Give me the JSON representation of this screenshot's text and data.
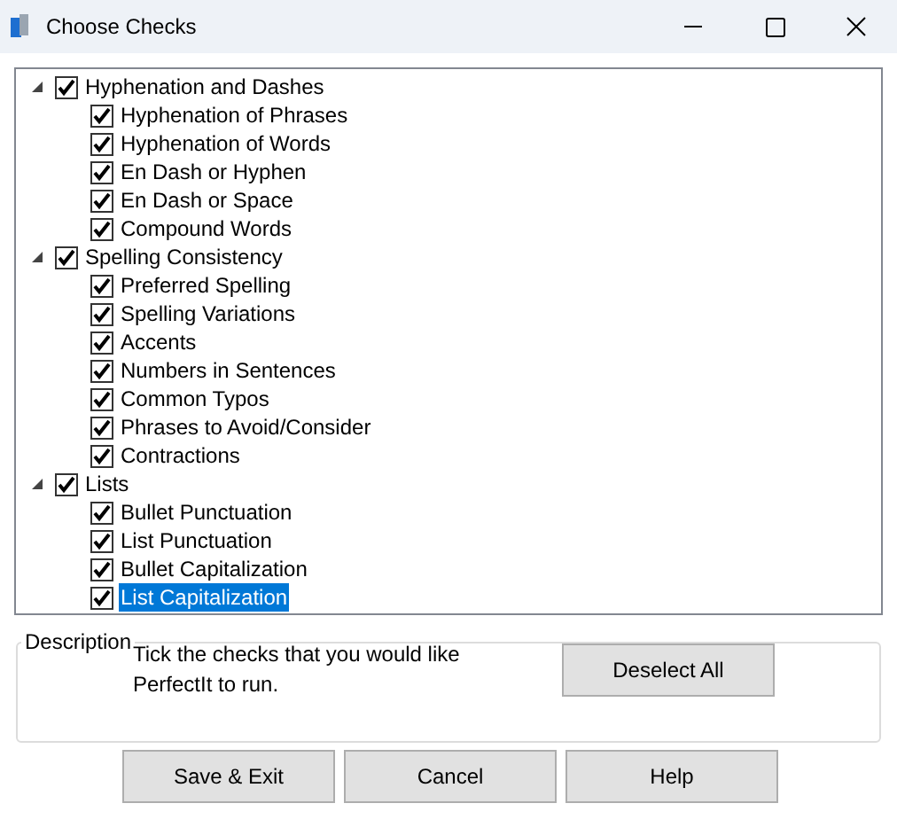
{
  "window": {
    "title": "Choose Checks"
  },
  "checks": [
    {
      "label": "Hyphenation and Dashes",
      "checked": true,
      "expanded": true,
      "selected": false,
      "children": [
        {
          "label": "Hyphenation of Phrases",
          "checked": true,
          "selected": false
        },
        {
          "label": "Hyphenation of Words",
          "checked": true,
          "selected": false
        },
        {
          "label": "En Dash or Hyphen",
          "checked": true,
          "selected": false
        },
        {
          "label": "En Dash or Space",
          "checked": true,
          "selected": false
        },
        {
          "label": "Compound Words",
          "checked": true,
          "selected": false
        }
      ]
    },
    {
      "label": "Spelling Consistency",
      "checked": true,
      "expanded": true,
      "selected": false,
      "children": [
        {
          "label": "Preferred Spelling",
          "checked": true,
          "selected": false
        },
        {
          "label": "Spelling Variations",
          "checked": true,
          "selected": false
        },
        {
          "label": "Accents",
          "checked": true,
          "selected": false
        },
        {
          "label": "Numbers in Sentences",
          "checked": true,
          "selected": false
        },
        {
          "label": "Common Typos",
          "checked": true,
          "selected": false
        },
        {
          "label": "Phrases to Avoid/Consider",
          "checked": true,
          "selected": false
        },
        {
          "label": "Contractions",
          "checked": true,
          "selected": false
        }
      ]
    },
    {
      "label": "Lists",
      "checked": true,
      "expanded": true,
      "selected": false,
      "children": [
        {
          "label": "Bullet Punctuation",
          "checked": true,
          "selected": false
        },
        {
          "label": "List Punctuation",
          "checked": true,
          "selected": false
        },
        {
          "label": "Bullet Capitalization",
          "checked": true,
          "selected": false
        },
        {
          "label": "List Capitalization",
          "checked": true,
          "selected": true
        }
      ]
    }
  ],
  "description": {
    "title": "Description",
    "text": "Tick the checks that you would like PerfectIt to run.",
    "button": "Deselect All"
  },
  "buttons": [
    "Save & Exit",
    "Cancel",
    "Help"
  ]
}
